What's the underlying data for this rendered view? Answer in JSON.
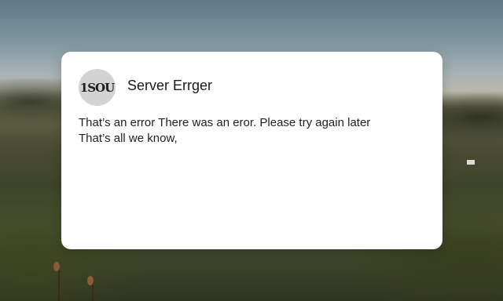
{
  "dialog": {
    "logo_text": "1SOU",
    "title": "Server Errger",
    "message_lines": [
      "That’s an error There was an eror. Please try again later",
      "That’s all we know,"
    ]
  }
}
